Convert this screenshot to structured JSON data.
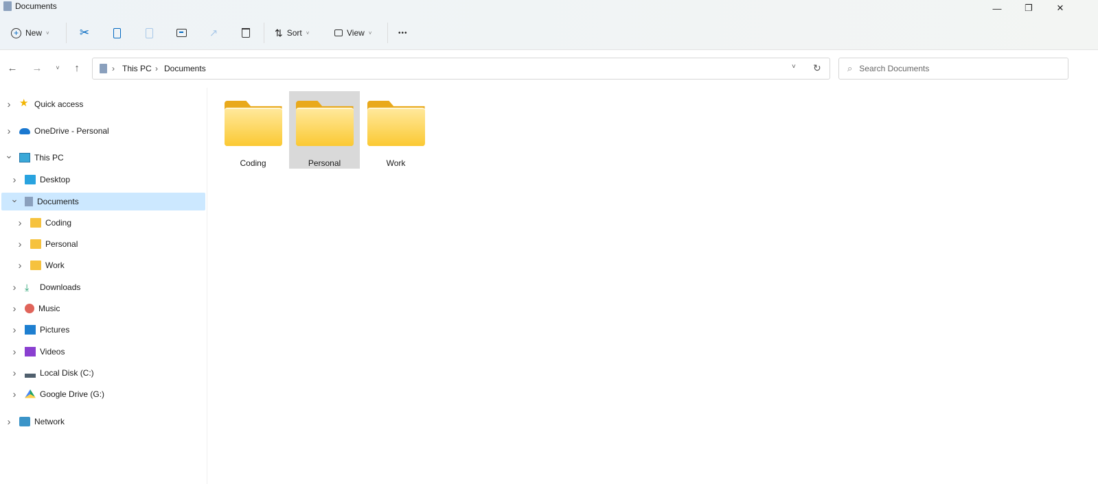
{
  "window": {
    "title": "Documents",
    "minimize": "—",
    "restore": "❐",
    "close": "✕"
  },
  "toolbar": {
    "new_label": "New",
    "sort_label": "Sort",
    "view_label": "View",
    "more": "•••"
  },
  "address": {
    "crumbs": [
      "This PC",
      "Documents"
    ],
    "sep": "›"
  },
  "search": {
    "placeholder": "Search Documents"
  },
  "sidebar": {
    "items": [
      {
        "label": "Quick access",
        "icon": "star-icon",
        "level": 0,
        "expanded": false
      },
      {
        "label": "OneDrive - Personal",
        "icon": "onedrive-icon",
        "level": 0,
        "expanded": false
      },
      {
        "label": "This PC",
        "icon": "computer-icon",
        "level": 0,
        "expanded": true
      },
      {
        "label": "Desktop",
        "icon": "desktop-icon",
        "level": 1,
        "expanded": false
      },
      {
        "label": "Documents",
        "icon": "documents-icon",
        "level": 1,
        "expanded": true,
        "selected": true
      },
      {
        "label": "Coding",
        "icon": "folder-icon",
        "level": 2,
        "expanded": false
      },
      {
        "label": "Personal",
        "icon": "folder-icon",
        "level": 2,
        "expanded": false
      },
      {
        "label": "Work",
        "icon": "folder-icon",
        "level": 2,
        "expanded": false
      },
      {
        "label": "Downloads",
        "icon": "downloads-icon",
        "level": 1,
        "expanded": false
      },
      {
        "label": "Music",
        "icon": "music-icon",
        "level": 1,
        "expanded": false
      },
      {
        "label": "Pictures",
        "icon": "pictures-icon",
        "level": 1,
        "expanded": false
      },
      {
        "label": "Videos",
        "icon": "videos-icon",
        "level": 1,
        "expanded": false
      },
      {
        "label": "Local Disk (C:)",
        "icon": "disk-icon",
        "level": 1,
        "expanded": false
      },
      {
        "label": "Google Drive (G:)",
        "icon": "google-drive-icon",
        "level": 1,
        "expanded": false
      },
      {
        "label": "Network",
        "icon": "network-icon",
        "level": 0,
        "expanded": false
      }
    ]
  },
  "content": {
    "folders": [
      {
        "name": "Coding"
      },
      {
        "name": "Personal",
        "selected": true
      },
      {
        "name": "Work"
      }
    ]
  },
  "colors": {
    "selection": "#cce8ff",
    "folder": "#fbc933",
    "accent": "#0067c0"
  }
}
